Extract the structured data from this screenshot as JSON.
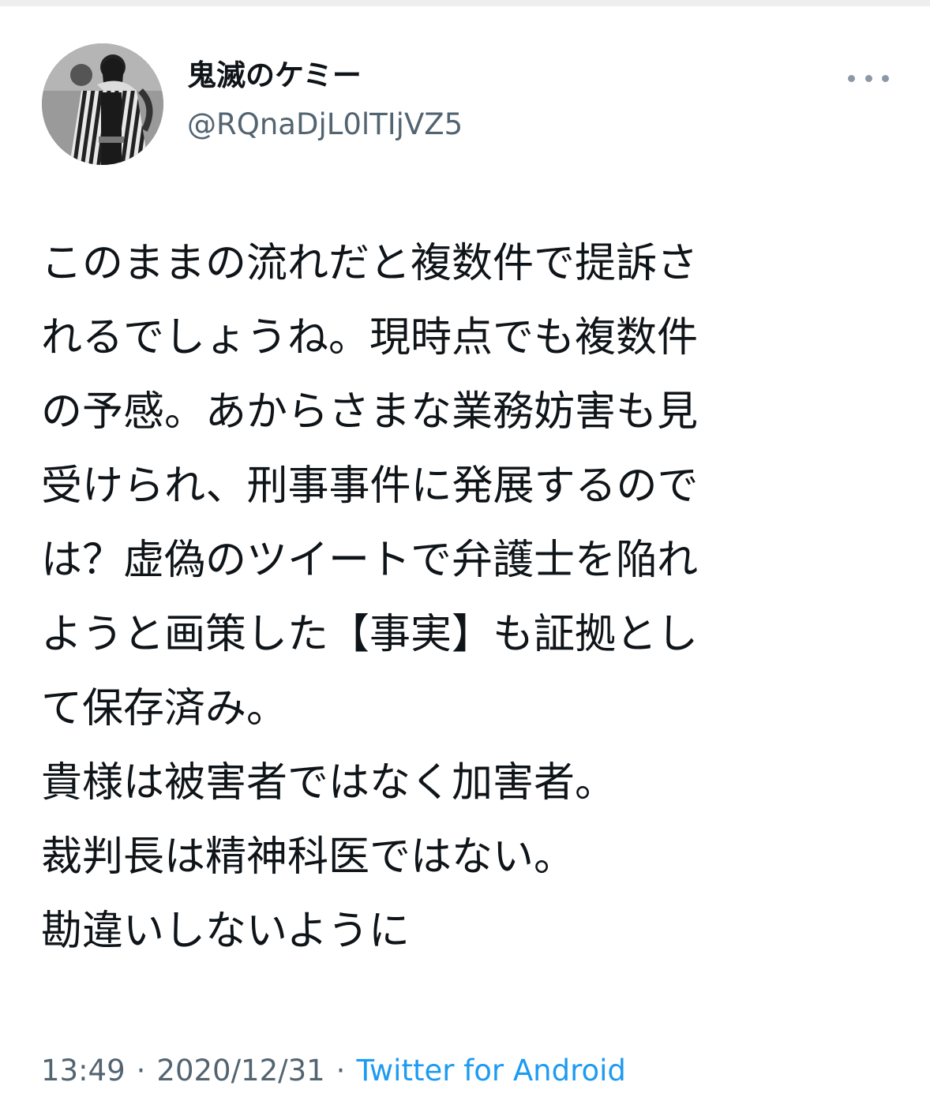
{
  "tweet": {
    "author": {
      "display_name": "鬼滅のケミー",
      "handle": "@RQnaDjL0lTIjVZ5"
    },
    "more_icon": "more-horizontal-icon",
    "text_lines": [
      "このままの流れだと複数件で提訴さ",
      "れるでしょうね。現時点でも複数件",
      "の予感。あからさまな業務妨害も見",
      "受けられ、刑事事件に発展するので",
      "は？虚偽のツイートで弁護士を陥れ",
      "ようと画策した【事実】も証拠とし",
      "て保存済み。",
      "貴様は被害者ではなく加害者。",
      "裁判長は精神科医ではない。",
      "勘違いしないように"
    ],
    "time": "13:49",
    "separator": "·",
    "date": "2020/12/31",
    "source": "Twitter for Android"
  },
  "colors": {
    "text": "#0f1419",
    "secondary": "#536471",
    "link": "#1d9bf0"
  }
}
